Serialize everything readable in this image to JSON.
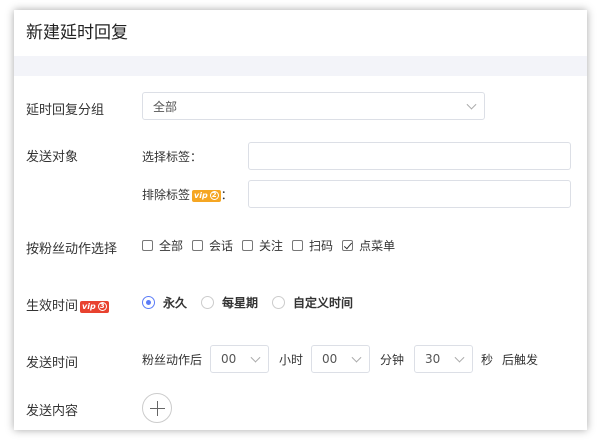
{
  "title": "新建延时回复",
  "group": {
    "label": "延时回复分组",
    "value": "全部"
  },
  "target": {
    "label": "发送对象",
    "select_tags_label": "选择标签：",
    "exclude_tags_label": "排除标签",
    "exclude_colon": "："
  },
  "vip_exclude": {
    "text": "vip",
    "num": "2"
  },
  "action": {
    "label": "按粉丝动作选择",
    "options": [
      {
        "label": "全部",
        "checked": false
      },
      {
        "label": "会话",
        "checked": false
      },
      {
        "label": "关注",
        "checked": false
      },
      {
        "label": "扫码",
        "checked": false
      },
      {
        "label": "点菜单",
        "checked": true
      }
    ]
  },
  "effective": {
    "label": "生效时间",
    "vip": {
      "text": "vip",
      "num": "3"
    },
    "options": [
      {
        "label": "永久",
        "selected": true
      },
      {
        "label": "每星期",
        "selected": false
      },
      {
        "label": "自定义时间",
        "selected": false
      }
    ]
  },
  "send_time": {
    "label": "发送时间",
    "prefix": "粉丝动作后",
    "hour": "00",
    "hour_unit": "小时",
    "minute": "00",
    "minute_unit": "分钟",
    "second": "30",
    "second_unit": "秒",
    "suffix": "后触发"
  },
  "content": {
    "label": "发送内容"
  },
  "colors": {
    "accent": "#5b7cf7",
    "vip_orange": "#f5a623",
    "vip_red": "#e8422f"
  }
}
